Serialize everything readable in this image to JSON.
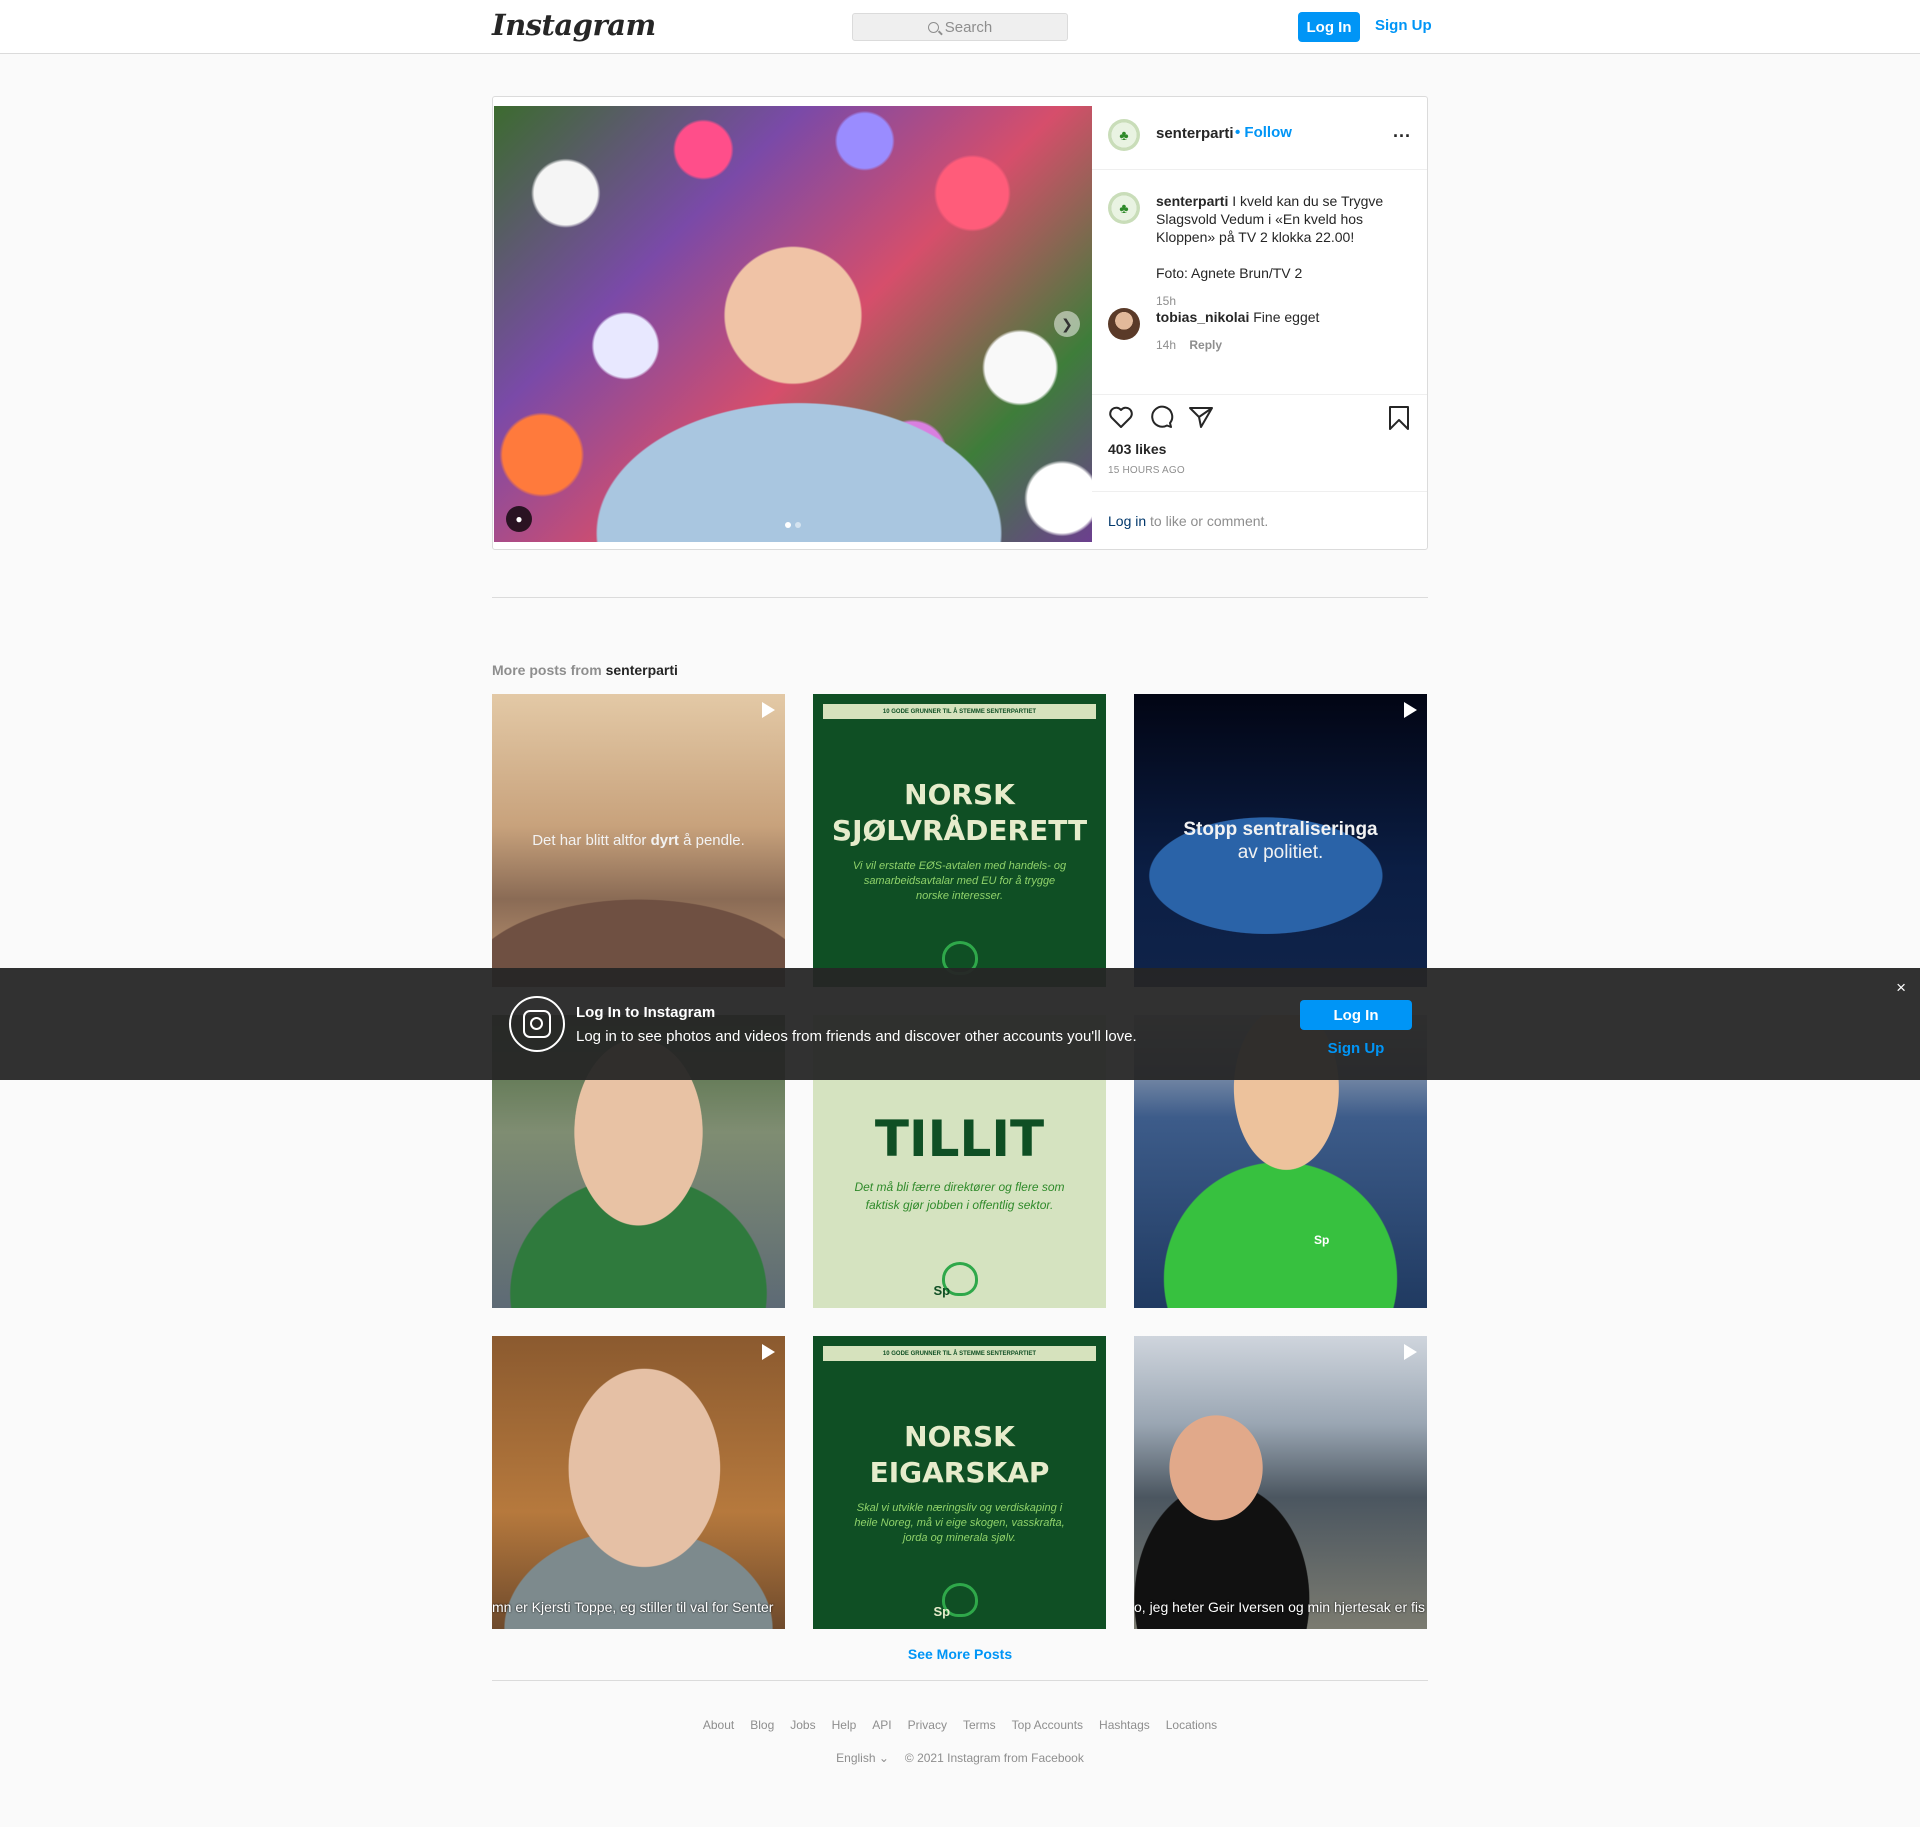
{
  "nav": {
    "logo": "Instagram",
    "search_placeholder": "Search",
    "login_label": "Log In",
    "signup_label": "Sign Up"
  },
  "post": {
    "username": "senterparti",
    "follow_label": "• Follow",
    "more_label": "...",
    "caption_user": "senterparti",
    "caption_text": "I kveld kan du se Trygve Slagsvold Vedum i «En kveld hos Kloppen» på TV 2 klokka 22.00!",
    "photo_credit": "Foto: Agnete Brun/TV 2",
    "caption_age": "15h",
    "comment": {
      "user": "tobias_nikolai",
      "text": "Fine egget",
      "age": "14h",
      "reply_label": "Reply"
    },
    "likes": "403 likes",
    "posted": "15 HOURS AGO",
    "login_link": "Log in",
    "login_suffix": " to like or comment."
  },
  "more_posts": {
    "prefix": "More posts from ",
    "user": "senterparti",
    "tiles": [
      {
        "type": "video",
        "text_pre": "Det har blitt altfor ",
        "text_bold": "dyrt",
        "text_post": " å pendle."
      },
      {
        "type": "graphic",
        "band": "10 GODE GRUNNER TIL Å STEMME SENTERPARTIET",
        "big1": "NORSK",
        "big2": "SJØLVRÅDERETT",
        "small": "Vi vil erstatte EØS-avtalen med handels- og samarbeidsavtalar med EU for å trygge norske interesser."
      },
      {
        "type": "video",
        "text_bold": "Stopp sentraliseringa",
        "text_post": "av politiet."
      },
      {
        "type": "photo"
      },
      {
        "type": "graphic",
        "big1": "TILLIT",
        "small": "Det må bli færre direktører og flere som faktisk gjør jobben i offentlig sektor.",
        "logo": "Sp"
      },
      {
        "type": "photo",
        "shirt_logo": "Sp"
      },
      {
        "type": "video",
        "caption": "mn er Kjersti Toppe, eg stiller til val for Senter"
      },
      {
        "type": "graphic",
        "band": "10 GODE GRUNNER TIL Å STEMME SENTERPARTIET",
        "big1": "NORSK",
        "big2": "EIGARSKAP",
        "small": "Skal vi utvikle næringsliv og verdiskaping i heile Noreg, må vi eige skogen, vasskrafta, jorda og minerala sjølv.",
        "logo": "Sp"
      },
      {
        "type": "video",
        "caption": "o, jeg heter Geir Iversen og min hjertesak er fis"
      }
    ],
    "see_more": "See More Posts"
  },
  "banner": {
    "title": "Log In to Instagram",
    "subtitle": "Log in to see photos and videos from friends and discover other accounts you'll love.",
    "login_label": "Log In",
    "signup_label": "Sign Up",
    "close": "×"
  },
  "footer": {
    "links": [
      "About",
      "Blog",
      "Jobs",
      "Help",
      "API",
      "Privacy",
      "Terms",
      "Top Accounts",
      "Hashtags",
      "Locations"
    ],
    "language": "English",
    "copyright": "© 2021 Instagram from Facebook"
  },
  "colors": {
    "accent": "#0095f6",
    "party_green": "#0f4f24"
  }
}
